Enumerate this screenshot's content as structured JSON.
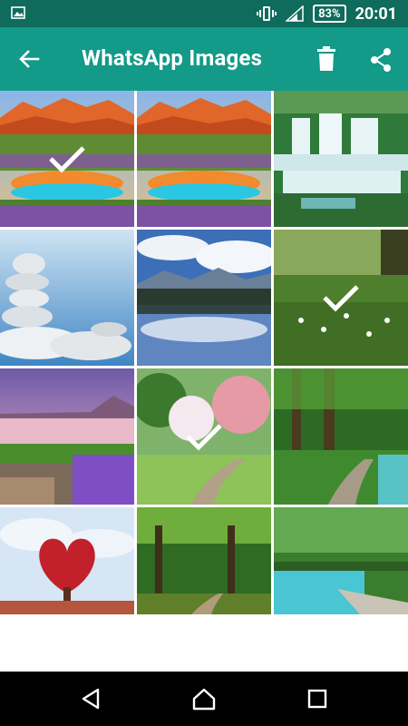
{
  "status": {
    "battery": "83%",
    "time": "20:01"
  },
  "appbar": {
    "title": "WhatsApp Images"
  },
  "colors": {
    "statusbar": "#0f6b5c",
    "appbar": "#139a88",
    "navbar": "#000000"
  },
  "images": [
    {
      "name": "mountain-lake-flowers",
      "selected": true
    },
    {
      "name": "mountain-lake-flowers-2",
      "selected": false
    },
    {
      "name": "waterfall",
      "selected": false
    },
    {
      "name": "stacked-stones",
      "selected": false
    },
    {
      "name": "lake-reflection",
      "selected": false
    },
    {
      "name": "green-meadow",
      "selected": true
    },
    {
      "name": "purple-lake-flowers",
      "selected": false
    },
    {
      "name": "blossom-path",
      "selected": true
    },
    {
      "name": "forest-river-path",
      "selected": false
    },
    {
      "name": "heart-tree",
      "selected": false
    },
    {
      "name": "green-forest-path",
      "selected": false
    },
    {
      "name": "lakeside-walkway",
      "selected": false
    }
  ]
}
